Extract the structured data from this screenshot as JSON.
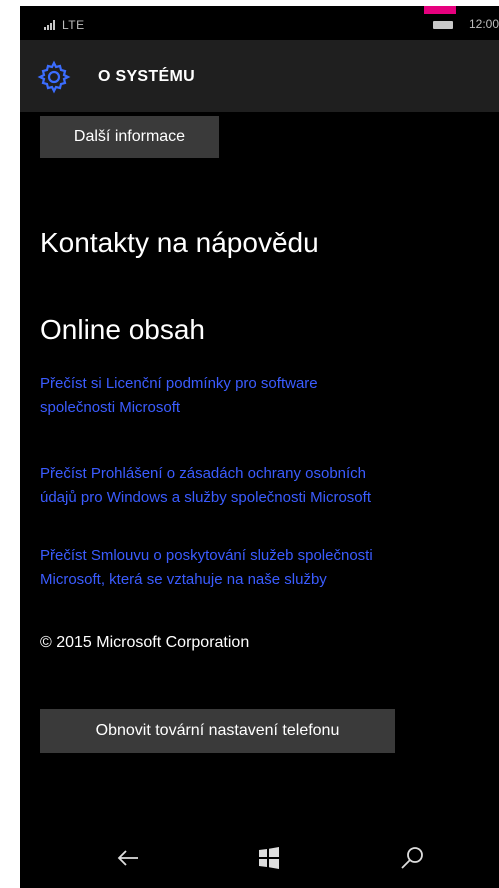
{
  "status": {
    "network": "LTE",
    "time": "12:00"
  },
  "header": {
    "title": "O SYSTÉMU",
    "icon": "gear-icon"
  },
  "more_info_button": "Další informace",
  "sections": {
    "contacts": "Kontakty na nápovědu",
    "online": "Online obsah"
  },
  "links": {
    "license": [
      "Přečíst si Licenční podmínky pro software",
      "společnosti Microsoft"
    ],
    "privacy": [
      "Přečíst Prohlášení o zásadách ochrany osobních",
      "údajů pro Windows a služby společnosti Microsoft"
    ],
    "services": [
      "Přečíst Smlouvu o poskytování služeb společnosti",
      "Microsoft, která se vztahuje na naše služby"
    ]
  },
  "copyright": "© 2015 Microsoft Corporation",
  "reset_button": "Obnovit tovární nastavení telefonu",
  "colors": {
    "accent": "#3b5cff",
    "background": "#000000",
    "header": "#1f1f1f",
    "button": "#3a3a3a",
    "corner": "#e6007e"
  },
  "navbar": [
    "back-arrow-icon",
    "windows-logo-icon",
    "search-icon"
  ]
}
